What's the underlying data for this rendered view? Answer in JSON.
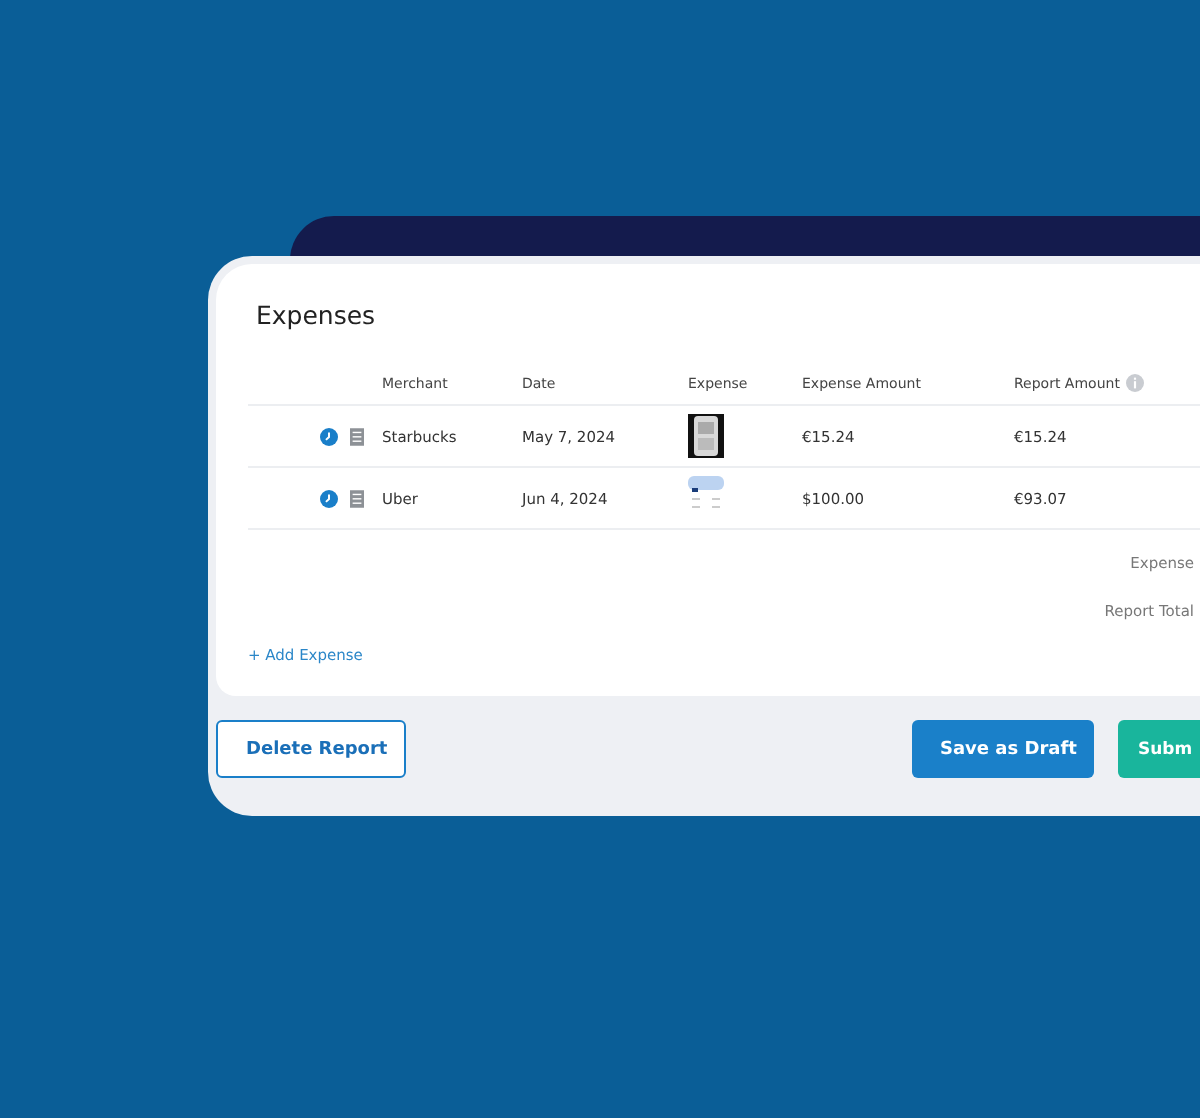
{
  "section_title": "Expenses",
  "table": {
    "columns": [
      "Merchant",
      "Date",
      "Expense",
      "Expense Amount",
      "Report Amount"
    ],
    "rows": [
      {
        "merchant": "Starbucks",
        "date": "May 7, 2024",
        "expense_amount": "€15.24",
        "report_amount": "€15.24"
      },
      {
        "merchant": "Uber",
        "date": "Jun 4, 2024",
        "expense_amount": "$100.00",
        "report_amount": "€93.07"
      }
    ]
  },
  "totals": [
    "Expense",
    "Report Total"
  ],
  "add_link": "+ Add Expense",
  "buttons": [
    {
      "label": "Delete Report",
      "kind": "outline"
    },
    {
      "label": "Save as Draft",
      "kind": "primary"
    },
    {
      "label": "Subm",
      "kind": "success"
    }
  ]
}
